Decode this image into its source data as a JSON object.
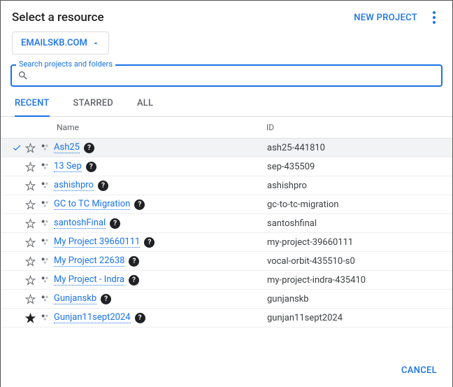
{
  "header": {
    "title": "Select a resource",
    "new_project": "NEW PROJECT"
  },
  "org": "EMAILSKB.COM",
  "search": {
    "label": "Search projects and folders",
    "value": ""
  },
  "tabs": [
    {
      "label": "RECENT",
      "active": true
    },
    {
      "label": "STARRED",
      "active": false
    },
    {
      "label": "ALL",
      "active": false
    }
  ],
  "columns": {
    "name": "Name",
    "id": "ID"
  },
  "rows": [
    {
      "selected": true,
      "starred": false,
      "name": "Ash25",
      "id": "ash25-441810"
    },
    {
      "selected": false,
      "starred": false,
      "name": "13 Sep",
      "id": "sep-435509"
    },
    {
      "selected": false,
      "starred": false,
      "name": "ashishpro",
      "id": "ashishpro"
    },
    {
      "selected": false,
      "starred": false,
      "name": "GC to TC Migration",
      "id": "gc-to-tc-migration"
    },
    {
      "selected": false,
      "starred": false,
      "name": "santoshFinal",
      "id": "santoshfinal"
    },
    {
      "selected": false,
      "starred": false,
      "name": "My Project 39660111",
      "id": "my-project-39660111"
    },
    {
      "selected": false,
      "starred": false,
      "name": "My Project 22638",
      "id": "vocal-orbit-435510-s0"
    },
    {
      "selected": false,
      "starred": false,
      "name": "My Project - Indra",
      "id": "my-project-indra-435410"
    },
    {
      "selected": false,
      "starred": false,
      "name": "Gunjanskb",
      "id": "gunjanskb"
    },
    {
      "selected": false,
      "starred": true,
      "name": "Gunjan11sept2024",
      "id": "gunjan11sept2024"
    }
  ],
  "footer": {
    "cancel": "CANCEL"
  }
}
